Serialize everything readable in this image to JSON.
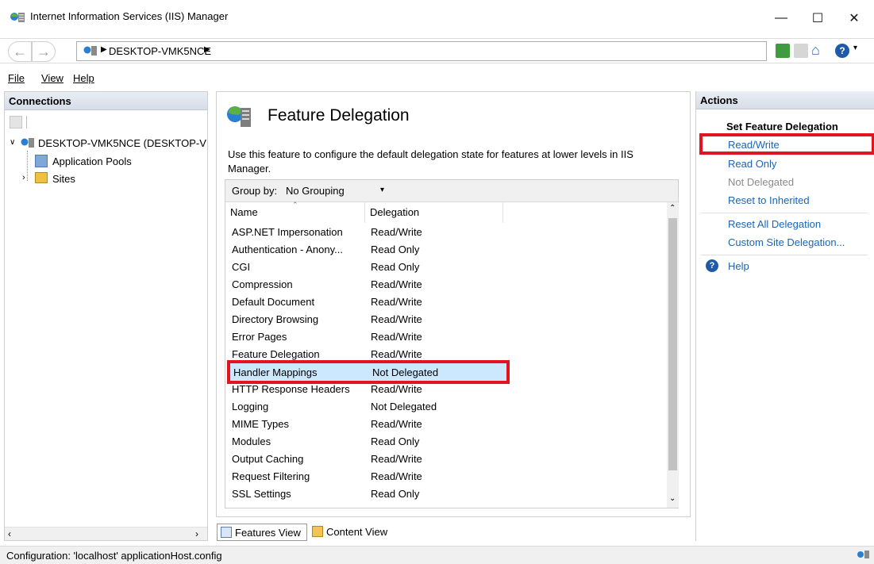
{
  "window": {
    "title": "Internet Information Services (IIS) Manager"
  },
  "address": {
    "crumb": "DESKTOP-VMK5NCE"
  },
  "menu": [
    {
      "label": "File"
    },
    {
      "label": "View"
    },
    {
      "label": "Help"
    }
  ],
  "connections": {
    "title": "Connections",
    "tree": [
      {
        "label": "DESKTOP-VMK5NCE (DESKTOP-V"
      },
      {
        "label": "Application Pools"
      },
      {
        "label": "Sites"
      }
    ]
  },
  "center": {
    "title": "Feature Delegation",
    "description": "Use this feature to configure the default delegation state for features at lower levels in IIS Manager.",
    "group_label": "Group by:",
    "group_value": "No Grouping",
    "columns": {
      "name": "Name",
      "delegation": "Delegation"
    },
    "rows": [
      {
        "name": "ASP.NET Impersonation",
        "delegation": "Read/Write"
      },
      {
        "name": "Authentication - Anony...",
        "delegation": "Read Only"
      },
      {
        "name": "CGI",
        "delegation": "Read Only"
      },
      {
        "name": "Compression",
        "delegation": "Read/Write"
      },
      {
        "name": "Default Document",
        "delegation": "Read/Write"
      },
      {
        "name": "Directory Browsing",
        "delegation": "Read/Write"
      },
      {
        "name": "Error Pages",
        "delegation": "Read/Write"
      },
      {
        "name": "Feature Delegation",
        "delegation": "Read/Write"
      },
      {
        "name": "Handler Mappings",
        "delegation": "Not Delegated"
      },
      {
        "name": "HTTP Response Headers",
        "delegation": "Read/Write"
      },
      {
        "name": "Logging",
        "delegation": "Not Delegated"
      },
      {
        "name": "MIME Types",
        "delegation": "Read/Write"
      },
      {
        "name": "Modules",
        "delegation": "Read Only"
      },
      {
        "name": "Output Caching",
        "delegation": "Read/Write"
      },
      {
        "name": "Request Filtering",
        "delegation": "Read/Write"
      },
      {
        "name": "SSL Settings",
        "delegation": "Read Only"
      }
    ],
    "bottom_tabs": {
      "features": "Features View",
      "content": "Content View"
    }
  },
  "actions": {
    "title": "Actions",
    "section": "Set Feature Delegation",
    "read_write": "Read/Write",
    "read_only": "Read Only",
    "not_delegated": "Not Delegated",
    "reset_inherited": "Reset to Inherited",
    "reset_all": "Reset All Delegation",
    "custom_site": "Custom Site Delegation...",
    "help": "Help"
  },
  "status": {
    "text": "Configuration: 'localhost' applicationHost.config"
  },
  "colors": {
    "accent_link": "#1a65b5",
    "highlight": "#e3141f",
    "selected_row": "#cce8ff"
  }
}
